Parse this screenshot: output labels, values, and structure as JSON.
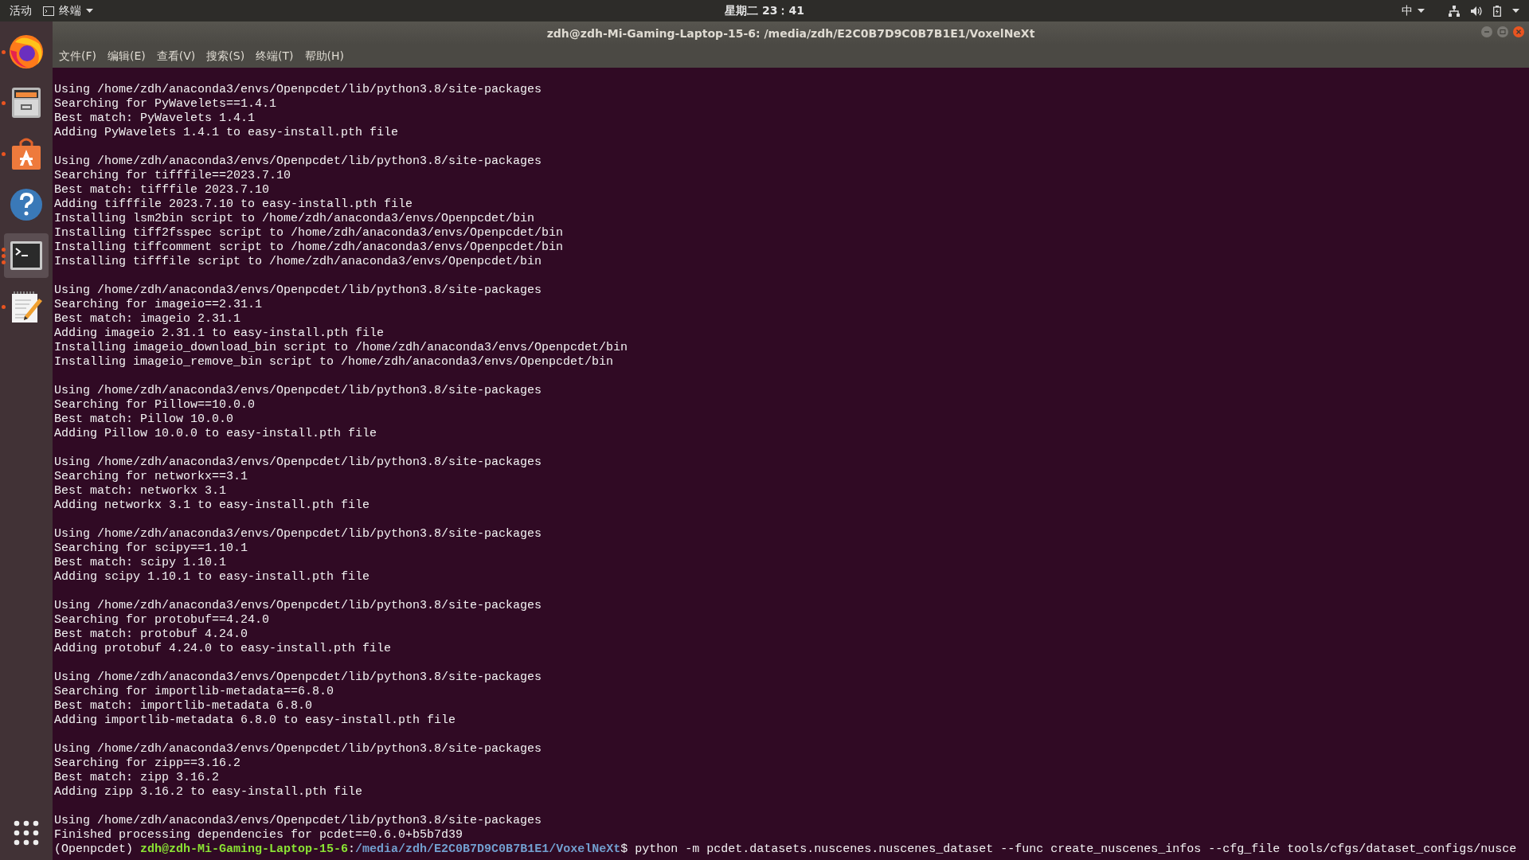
{
  "top_bar": {
    "activities": "活动",
    "app_menu": "终端",
    "clock": "星期二 23：41",
    "input_method": "中"
  },
  "dock": {
    "items": [
      {
        "kind": "browser",
        "selected": false,
        "running": true
      },
      {
        "kind": "files",
        "selected": false,
        "running": true
      },
      {
        "kind": "store",
        "selected": false,
        "running": true
      },
      {
        "kind": "help",
        "selected": false,
        "running": false
      },
      {
        "kind": "terminal",
        "selected": true,
        "running": true,
        "multiple_windows": true
      },
      {
        "kind": "editor",
        "selected": false,
        "running": true
      }
    ]
  },
  "window": {
    "title": "zdh@zdh-Mi-Gaming-Laptop-15-6: /media/zdh/E2C0B7D9C0B7B1E1/VoxelNeXt",
    "menu": [
      "文件(F)",
      "编辑(E)",
      "查看(V)",
      "搜索(S)",
      "终端(T)",
      "帮助(H)"
    ]
  },
  "terminal": {
    "blocks": [
      [
        "Using /home/zdh/anaconda3/envs/Openpcdet/lib/python3.8/site-packages",
        "Searching for PyWavelets==1.4.1",
        "Best match: PyWavelets 1.4.1",
        "Adding PyWavelets 1.4.1 to easy-install.pth file"
      ],
      [
        "Using /home/zdh/anaconda3/envs/Openpcdet/lib/python3.8/site-packages",
        "Searching for tifffile==2023.7.10",
        "Best match: tifffile 2023.7.10",
        "Adding tifffile 2023.7.10 to easy-install.pth file",
        "Installing lsm2bin script to /home/zdh/anaconda3/envs/Openpcdet/bin",
        "Installing tiff2fsspec script to /home/zdh/anaconda3/envs/Openpcdet/bin",
        "Installing tiffcomment script to /home/zdh/anaconda3/envs/Openpcdet/bin",
        "Installing tifffile script to /home/zdh/anaconda3/envs/Openpcdet/bin"
      ],
      [
        "Using /home/zdh/anaconda3/envs/Openpcdet/lib/python3.8/site-packages",
        "Searching for imageio==2.31.1",
        "Best match: imageio 2.31.1",
        "Adding imageio 2.31.1 to easy-install.pth file",
        "Installing imageio_download_bin script to /home/zdh/anaconda3/envs/Openpcdet/bin",
        "Installing imageio_remove_bin script to /home/zdh/anaconda3/envs/Openpcdet/bin"
      ],
      [
        "Using /home/zdh/anaconda3/envs/Openpcdet/lib/python3.8/site-packages",
        "Searching for Pillow==10.0.0",
        "Best match: Pillow 10.0.0",
        "Adding Pillow 10.0.0 to easy-install.pth file"
      ],
      [
        "Using /home/zdh/anaconda3/envs/Openpcdet/lib/python3.8/site-packages",
        "Searching for networkx==3.1",
        "Best match: networkx 3.1",
        "Adding networkx 3.1 to easy-install.pth file"
      ],
      [
        "Using /home/zdh/anaconda3/envs/Openpcdet/lib/python3.8/site-packages",
        "Searching for scipy==1.10.1",
        "Best match: scipy 1.10.1",
        "Adding scipy 1.10.1 to easy-install.pth file"
      ],
      [
        "Using /home/zdh/anaconda3/envs/Openpcdet/lib/python3.8/site-packages",
        "Searching for protobuf==4.24.0",
        "Best match: protobuf 4.24.0",
        "Adding protobuf 4.24.0 to easy-install.pth file"
      ],
      [
        "Using /home/zdh/anaconda3/envs/Openpcdet/lib/python3.8/site-packages",
        "Searching for importlib-metadata==6.8.0",
        "Best match: importlib-metadata 6.8.0",
        "Adding importlib-metadata 6.8.0 to easy-install.pth file"
      ],
      [
        "Using /home/zdh/anaconda3/envs/Openpcdet/lib/python3.8/site-packages",
        "Searching for zipp==3.16.2",
        "Best match: zipp 3.16.2",
        "Adding zipp 3.16.2 to easy-install.pth file"
      ],
      [
        "Using /home/zdh/anaconda3/envs/Openpcdet/lib/python3.8/site-packages",
        "Finished processing dependencies for pcdet==0.6.0+b5b7d39"
      ]
    ],
    "prompt": {
      "env": "(Openpcdet)",
      "user_host": "zdh@zdh-Mi-Gaming-Laptop-15-6",
      "separator": ":",
      "path": "/media/zdh/E2C0B7D9C0B7B1E1/VoxelNeXt",
      "symbol": "$",
      "command": "python -m pcdet.datasets.nuscenes.nuscenes_dataset --func create_nuscenes_infos --cfg_file tools/cfgs/dataset_configs/nusce"
    }
  }
}
